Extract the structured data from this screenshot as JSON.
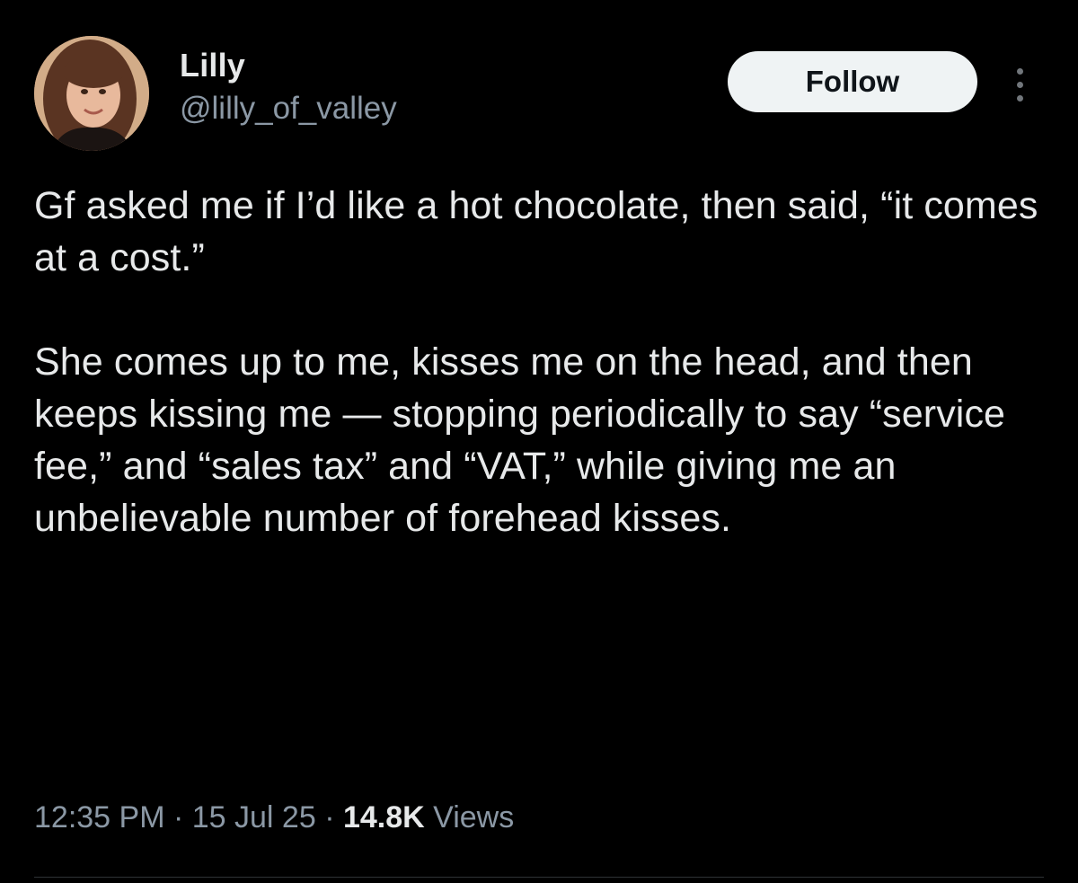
{
  "author": {
    "display_name": "Lilly",
    "handle": "@lilly_of_valley",
    "avatar_icon": "profile-photo"
  },
  "actions": {
    "follow_label": "Follow",
    "more_icon": "more-vertical-icon"
  },
  "tweet": {
    "paragraphs": [
      "Gf asked me if I’d like a hot chocolate, then said, “it comes at a cost.”",
      "She comes up to me, kisses me on the head, and then keeps kissing me — stopping periodically to say “service fee,” and “sales tax” and “VAT,” while giving me an unbelievable number of forehead kisses."
    ]
  },
  "meta": {
    "time": "12:35 PM",
    "separator": " · ",
    "date": "15 Jul 25",
    "views_count": "14.8K",
    "views_label": " Views"
  },
  "colors": {
    "background": "#000000",
    "text_primary": "#e7e9ea",
    "text_secondary": "#8b98a5",
    "follow_bg": "#eff3f4"
  }
}
